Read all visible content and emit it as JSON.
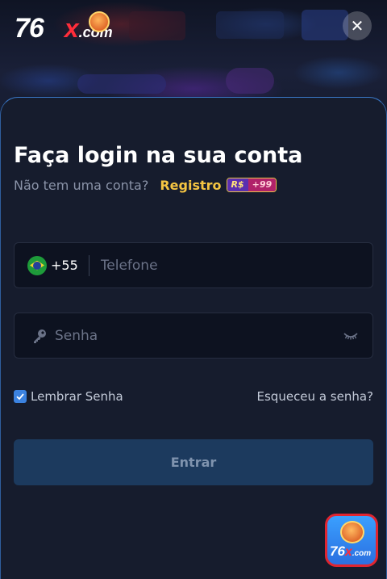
{
  "header": {
    "logo_number": "76",
    "logo_x": "x",
    "logo_domain": ".com",
    "close_icon": "close-icon"
  },
  "login": {
    "title": "Faça login na sua conta",
    "subtitle": "Não tem uma conta?",
    "register_link": "Registro",
    "bonus_currency": "R$",
    "bonus_amount": "+99"
  },
  "phone_field": {
    "flag_icon": "brazil-flag-icon",
    "country_code": "+55",
    "placeholder": "Telefone",
    "value": ""
  },
  "password_field": {
    "icon": "key-icon",
    "placeholder": "Senha",
    "value": "",
    "visibility_icon": "eye-closed-icon"
  },
  "remember": {
    "label": "Lembrar Senha",
    "checked": true
  },
  "forgot_password": "Esqueceu a senha?",
  "submit_label": "Entrar",
  "floating_app": {
    "number": "76",
    "x": "x",
    "domain": ".com"
  },
  "colors": {
    "background": "#161c2d",
    "accent_border": "#3a78c8",
    "register_link": "#f5c542",
    "submit_bg": "#1c3a5e",
    "checkbox": "#3b82e0",
    "brand_red": "#ff2d3a"
  }
}
